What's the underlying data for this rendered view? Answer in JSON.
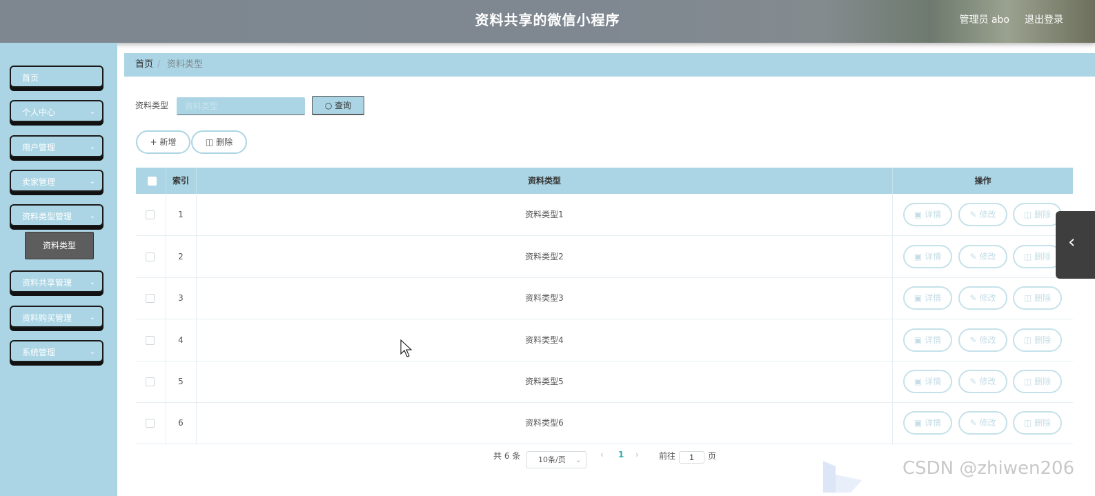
{
  "header": {
    "title": "资料共享的微信小程序",
    "user": "管理员 abo",
    "logout": "退出登录"
  },
  "sidebar": {
    "items": [
      {
        "label": "首页",
        "chevron": false
      },
      {
        "label": "个人中心",
        "chevron": true
      },
      {
        "label": "用户管理",
        "chevron": true
      },
      {
        "label": "卖家管理",
        "chevron": true
      },
      {
        "label": "资料类型管理",
        "chevron": true
      },
      {
        "label": "资料共享管理",
        "chevron": true
      },
      {
        "label": "资料购买管理",
        "chevron": true
      },
      {
        "label": "系统管理",
        "chevron": true
      }
    ],
    "active_sub": "资料类型"
  },
  "breadcrumb": {
    "home": "首页",
    "separator": "/",
    "current": "资料类型"
  },
  "search": {
    "label": "资料类型",
    "placeholder": "资料类型",
    "value": "",
    "button": "查询"
  },
  "actions": {
    "add": "新增",
    "delete": "删除"
  },
  "table": {
    "columns": {
      "index": "索引",
      "type": "资料类型",
      "ops": "操作"
    },
    "rows": [
      {
        "index": "1",
        "type": "资料类型1"
      },
      {
        "index": "2",
        "type": "资料类型2"
      },
      {
        "index": "3",
        "type": "资料类型3"
      },
      {
        "index": "4",
        "type": "资料类型4"
      },
      {
        "index": "5",
        "type": "资料类型5"
      },
      {
        "index": "6",
        "type": "资料类型6"
      }
    ],
    "row_actions": {
      "detail": "详情",
      "edit": "修改",
      "delete": "删除"
    }
  },
  "pagination": {
    "total": "共 6 条",
    "page_size": "10条/页",
    "current_page": "1",
    "goto_label": "前往",
    "goto_value": "1",
    "page_unit": "页"
  },
  "watermark": "CSDN @zhiwen206",
  "colors": {
    "accent": "#abd5e4",
    "header": "#7f8891",
    "submenu_active": "#5d5d5d"
  }
}
